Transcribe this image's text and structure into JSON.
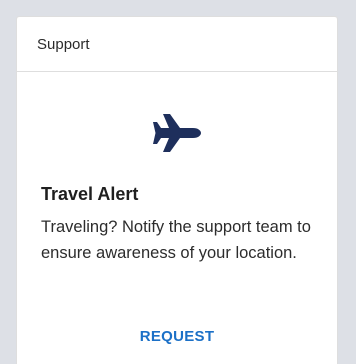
{
  "card": {
    "header_title": "Support",
    "icon": "airplane-icon",
    "icon_color": "#1e2f5c",
    "title": "Travel Alert",
    "description": "Traveling? Notify the support team to ensure awareness of your location.",
    "action_label": "REQUEST",
    "action_color": "#1b70c7"
  }
}
